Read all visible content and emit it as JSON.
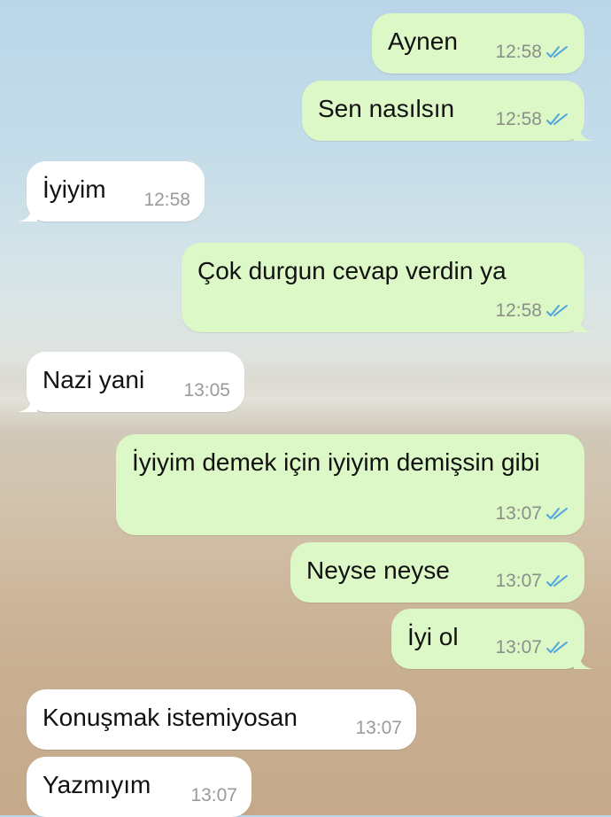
{
  "colors": {
    "outgoing_bubble": "#dcf8c6",
    "incoming_bubble": "#ffffff",
    "read_ticks": "#4fa3e0",
    "timestamp": "#8a8f8a"
  },
  "messages": [
    {
      "direction": "outgoing",
      "text": "Aynen",
      "time": "12:58",
      "status": "read"
    },
    {
      "direction": "outgoing",
      "text": "Sen nasılsın",
      "time": "12:58",
      "status": "read"
    },
    {
      "direction": "incoming",
      "text": "İyiyim",
      "time": "12:58"
    },
    {
      "direction": "outgoing",
      "text": "Çok durgun cevap verdin ya",
      "time": "12:58",
      "status": "read"
    },
    {
      "direction": "incoming",
      "text": "Nazi yani",
      "time": "13:05"
    },
    {
      "direction": "outgoing",
      "text": "İyiyim demek için iyiyim demişsin gibi",
      "time": "13:07",
      "status": "read"
    },
    {
      "direction": "outgoing",
      "text": "Neyse neyse",
      "time": "13:07",
      "status": "read"
    },
    {
      "direction": "outgoing",
      "text": "İyi ol",
      "time": "13:07",
      "status": "read"
    },
    {
      "direction": "incoming",
      "text": "Konuşmak istemiyosan",
      "time": "13:07"
    },
    {
      "direction": "incoming",
      "text": "Yazmıyım",
      "time": "13:07"
    }
  ]
}
